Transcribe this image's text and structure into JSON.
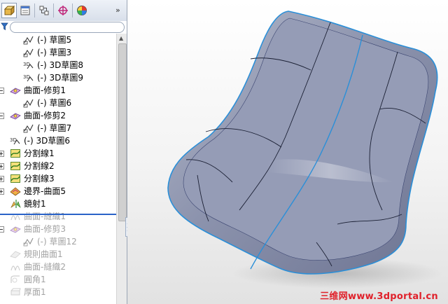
{
  "toolbar": {
    "buttons": [
      "feature-manager",
      "property-manager",
      "configuration-manager",
      "dimxpert-manager",
      "display-manager"
    ],
    "more": "»"
  },
  "filter": {
    "icon": "funnel-icon",
    "placeholder": ""
  },
  "tree": {
    "items": [
      {
        "label": "(-) 草圖5",
        "icon": "sketch-icon",
        "indent": 2,
        "state": "normal"
      },
      {
        "label": "(-) 草圖3",
        "icon": "sketch-icon",
        "indent": 2,
        "state": "normal"
      },
      {
        "label": "(-) 3D草圖8",
        "icon": "3d-sketch-icon",
        "indent": 2,
        "state": "normal"
      },
      {
        "label": "(-) 3D草圖9",
        "icon": "3d-sketch-icon",
        "indent": 2,
        "state": "normal"
      },
      {
        "label": "曲面-修剪1",
        "icon": "surface-trim-icon",
        "indent": 1,
        "state": "normal",
        "expander": "minus"
      },
      {
        "label": "(-) 草圖6",
        "icon": "sketch-icon",
        "indent": 2,
        "state": "normal"
      },
      {
        "label": "曲面-修剪2",
        "icon": "surface-trim-icon",
        "indent": 1,
        "state": "normal",
        "expander": "minus"
      },
      {
        "label": "(-) 草圖7",
        "icon": "sketch-icon",
        "indent": 2,
        "state": "normal"
      },
      {
        "label": "(-) 3D草圖6",
        "icon": "3d-sketch-icon",
        "indent": 1,
        "state": "normal"
      },
      {
        "label": "分割線1",
        "icon": "split-line-icon",
        "indent": 1,
        "state": "normal",
        "expander": "plus"
      },
      {
        "label": "分割線2",
        "icon": "split-line-icon",
        "indent": 1,
        "state": "normal",
        "expander": "plus"
      },
      {
        "label": "分割線3",
        "icon": "split-line-icon",
        "indent": 1,
        "state": "normal",
        "expander": "plus"
      },
      {
        "label": "邊界-曲面5",
        "icon": "boundary-surface-icon",
        "indent": 1,
        "state": "normal",
        "expander": "plus"
      },
      {
        "label": "鏡射1",
        "icon": "mirror-icon",
        "indent": 1,
        "state": "normal"
      },
      {
        "label": "曲面-縫織1",
        "icon": "surface-knit-icon",
        "indent": 1,
        "state": "dim"
      },
      {
        "label": "曲面-修剪3",
        "icon": "surface-trim-icon",
        "indent": 1,
        "state": "dim",
        "expander": "minus"
      },
      {
        "label": "(-) 草圖12",
        "icon": "sketch-icon",
        "indent": 2,
        "state": "dim"
      },
      {
        "label": "規則曲面1",
        "icon": "ruled-surface-icon",
        "indent": 1,
        "state": "dim"
      },
      {
        "label": "曲面-縫織2",
        "icon": "surface-knit-icon",
        "indent": 1,
        "state": "dim"
      },
      {
        "label": "圓角1",
        "icon": "fillet-icon",
        "indent": 1,
        "state": "dim"
      },
      {
        "label": "厚面1",
        "icon": "thicken-icon",
        "indent": 1,
        "state": "dim"
      }
    ]
  },
  "viewport": {
    "model": "seat-shell-surface-model",
    "body_color": "#8c93ad",
    "edge_color": "#2a8fd8",
    "watermark": "三维网www.3dportal.cn",
    "watermark_color": "#e0202a"
  },
  "colors": {
    "accent": "#2a63c8",
    "disabled_text": "#a3a3a3"
  }
}
